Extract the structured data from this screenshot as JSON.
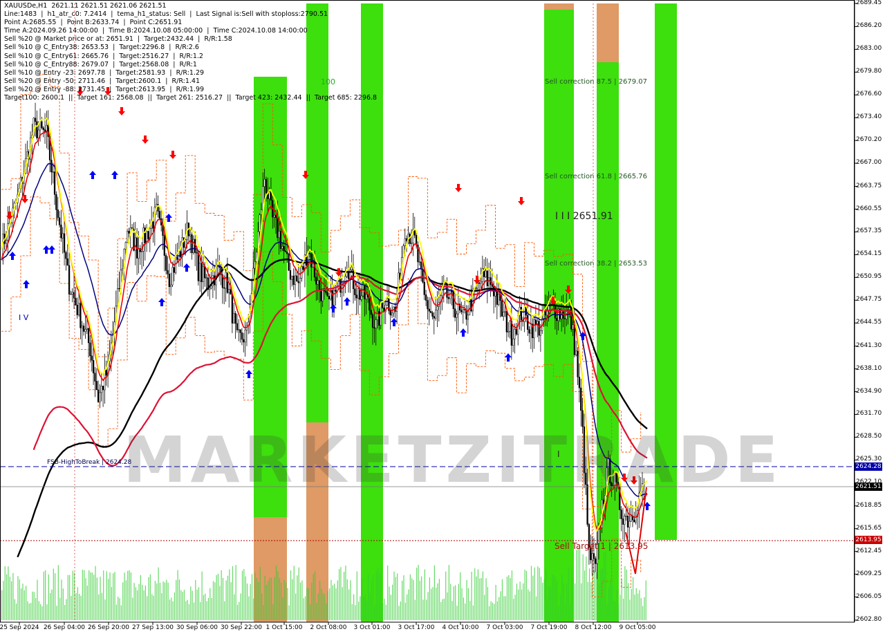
{
  "info_lines": [
    "XAUUSDe,H1  2621.11 2621.51 2621.06 2621.51",
    "Line:1483  |  h1_atr_c0: 7.2414  |  tema_h1_status: Sell  |  Last Signal is:Sell with stoploss:2790.51",
    "Point A:2685.55  |  Point B:2633.74  |  Point C:2651.91",
    "Time A:2024.09.26 14:00:00  |  Time B:2024.10.08 05:00:00  |  Time C:2024.10.08 14:00:00",
    "Sell %20 @ Market price or at: 2651.91  |  Target:2432.44  |  R/R:1.58",
    "Sell %10 @ C_Entry38: 2653.53  |  Target:2296.8  |  R/R:2.6",
    "Sell %10 @ C_Entry61: 2665.76  |  Target:2516.27  |  R/R:1.2",
    "Sell %10 @ C_Entry88: 2679.07  |  Target:2568.08  |  R/R:1",
    "Sell %10 @ Entry -23: 2697.78  |  Target:2581.93  |  R/R:1.29",
    "Sell %20 @ Entry -50: 2711.46  |  Target:2600.1  |  R/R:1.41",
    "Sell %20 @ Entry -88: 2731.45  |  Target:2613.95  |  R/R:1.99",
    "Target100: 2600.1  ||  Target 161: 2568.08  ||  Target 261: 2516.27  ||  Target 423: 2432.44  ||  Target 685: 2296.8"
  ],
  "annotations": {
    "sell_correction_875": "Sell correction 87.5 | 2679.07",
    "sell_correction_618": "Sell correction 61.8 | 2665.76",
    "sell_correction_382": "Sell correction 38.2 | 2653.53",
    "point_c_label": "I I I  2651.91",
    "fsb_label": "FSB-HighToBreak | 2624.28",
    "sell_target_label": "Sell Target 1 | 2613.95",
    "hundred_label": "100",
    "iv_label": "I V",
    "bar_label": "I"
  },
  "price_labels": {
    "fsb": "2624.28",
    "current": "2621.51",
    "target": "2613.95"
  },
  "watermark": "MARKETZITRADE",
  "colors": {
    "bull_zone": "#33dd00",
    "bear_zone": "#e8966a",
    "ma_fast": "#ffff00",
    "ma_red": "#ee0000",
    "ma_crimson": "#dd1133",
    "ma_navy": "#000080",
    "ma_black": "#000000",
    "fsb_line": "#0000aa",
    "target_line": "#aa0000",
    "volume": "#33cc33",
    "arrow_buy": "#0000ff",
    "arrow_sell": "#ff0000",
    "envelope": "#ff5500"
  },
  "chart_data": {
    "type": "candlestick",
    "symbol": "XAUUSDe",
    "timeframe": "H1",
    "ylim": [
      2602.8,
      2689.45
    ],
    "y_ticks": [
      2689.45,
      2686.2,
      2683.0,
      2679.8,
      2676.6,
      2673.4,
      2670.2,
      2667.0,
      2663.75,
      2660.55,
      2657.35,
      2654.15,
      2650.95,
      2647.75,
      2644.55,
      2641.3,
      2638.1,
      2634.9,
      2631.7,
      2628.5,
      2625.3,
      2622.1,
      2618.85,
      2615.65,
      2612.45,
      2609.25,
      2606.05,
      2602.8
    ],
    "x_ticks": [
      "25 Sep 2024",
      "26 Sep 04:00",
      "26 Sep 20:00",
      "27 Sep 13:00",
      "30 Sep 06:00",
      "30 Sep 22:00",
      "1 Oct 15:00",
      "2 Oct 08:00",
      "3 Oct 01:00",
      "3 Oct 17:00",
      "4 Oct 10:00",
      "7 Oct 03:00",
      "7 Oct 19:00",
      "8 Oct 12:00",
      "9 Oct 05:00"
    ],
    "close_path": [
      [
        0,
        2655
      ],
      [
        10,
        2662
      ],
      [
        20,
        2672
      ],
      [
        28,
        2671
      ],
      [
        35,
        2660
      ],
      [
        42,
        2650
      ],
      [
        48,
        2646
      ],
      [
        55,
        2641
      ],
      [
        60,
        2634
      ],
      [
        66,
        2638
      ],
      [
        72,
        2648
      ],
      [
        78,
        2658
      ],
      [
        84,
        2655
      ],
      [
        90,
        2657
      ],
      [
        96,
        2660
      ],
      [
        100,
        2656
      ],
      [
        104,
        2651
      ],
      [
        110,
        2654
      ],
      [
        116,
        2658
      ],
      [
        122,
        2652
      ],
      [
        128,
        2650
      ],
      [
        134,
        2652
      ],
      [
        140,
        2650
      ],
      [
        146,
        2642
      ],
      [
        152,
        2643
      ],
      [
        158,
        2655
      ],
      [
        163,
        2665
      ],
      [
        168,
        2659
      ],
      [
        172,
        2657
      ],
      [
        178,
        2652
      ],
      [
        184,
        2650
      ],
      [
        190,
        2655
      ],
      [
        196,
        2650
      ],
      [
        202,
        2647
      ],
      [
        208,
        2649
      ],
      [
        214,
        2653
      ],
      [
        220,
        2649
      ],
      [
        226,
        2648
      ],
      [
        232,
        2644
      ],
      [
        238,
        2648
      ],
      [
        244,
        2646
      ],
      [
        250,
        2658
      ],
      [
        256,
        2656
      ],
      [
        262,
        2648
      ],
      [
        268,
        2645
      ],
      [
        274,
        2649
      ],
      [
        280,
        2647
      ],
      [
        286,
        2645
      ],
      [
        292,
        2648
      ],
      [
        298,
        2651
      ],
      [
        304,
        2650
      ],
      [
        310,
        2646
      ],
      [
        316,
        2643
      ],
      [
        322,
        2646
      ],
      [
        328,
        2644
      ],
      [
        334,
        2644
      ],
      [
        340,
        2647
      ],
      [
        346,
        2646
      ],
      [
        352,
        2646
      ],
      [
        356,
        2640
      ],
      [
        360,
        2629
      ],
      [
        364,
        2612
      ],
      [
        368,
        2610
      ],
      [
        372,
        2619
      ],
      [
        376,
        2624
      ],
      [
        380,
        2622
      ],
      [
        384,
        2618
      ],
      [
        388,
        2617
      ],
      [
        392,
        2618
      ],
      [
        396,
        2621
      ]
    ],
    "volume_level": "low-to-medium histogram along bottom"
  }
}
